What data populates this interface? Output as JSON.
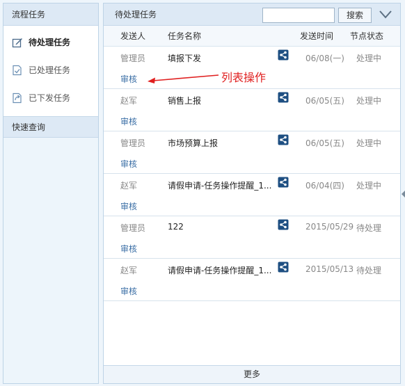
{
  "sidebar": {
    "title": "流程任务",
    "items": [
      {
        "label": "待处理任务",
        "icon": "edit-icon",
        "active": true
      },
      {
        "label": "已处理任务",
        "icon": "checked-doc-icon",
        "active": false
      },
      {
        "label": "已下发任务",
        "icon": "sent-doc-icon",
        "active": false
      }
    ],
    "quick_query_label": "快速查询"
  },
  "main": {
    "title": "待处理任务",
    "search": {
      "value": "",
      "placeholder": "",
      "button_label": "搜索"
    },
    "columns": [
      "发送人",
      "任务名称",
      "发送时间",
      "节点状态"
    ],
    "rows": [
      {
        "sender": "管理员",
        "title": "填报下发",
        "date": "06/08(一)",
        "status": "处理中",
        "action": "审核"
      },
      {
        "sender": "赵军",
        "title": "销售上报",
        "date": "06/05(五)",
        "status": "处理中",
        "action": "审核"
      },
      {
        "sender": "管理员",
        "title": "市场预算上报",
        "date": "06/05(五)",
        "status": "处理中",
        "action": "审核"
      },
      {
        "sender": "赵军",
        "title": "请假申请-任务操作提醒_1...",
        "date": "06/04(四)",
        "status": "处理中",
        "action": "审核"
      },
      {
        "sender": "管理员",
        "title": "122",
        "date": "2015/05/29",
        "status": "待处理",
        "action": "审核"
      },
      {
        "sender": "赵军",
        "title": "请假申请-任务操作提醒_1...",
        "date": "2015/05/13",
        "status": "待处理",
        "action": "审核"
      }
    ],
    "more_label": "更多"
  },
  "annotation": {
    "text": "列表操作",
    "color": "#e02020"
  },
  "colors": {
    "accent": "#3a6ea5",
    "header_bg": "#dde9f5",
    "border": "#bdd3e6"
  }
}
